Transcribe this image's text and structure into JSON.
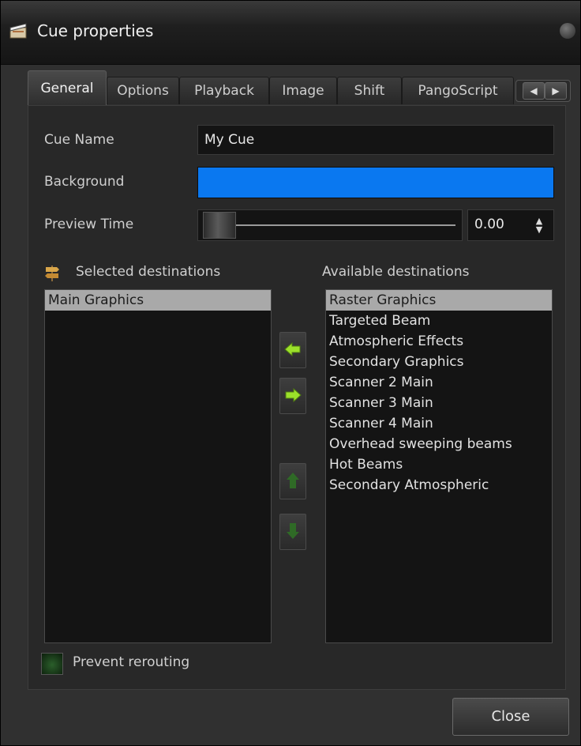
{
  "window": {
    "title": "Cue properties",
    "icon": "clapperboard-icon"
  },
  "tabs": [
    {
      "label": "General",
      "active": true
    },
    {
      "label": "Options",
      "active": false
    },
    {
      "label": "Playback",
      "active": false
    },
    {
      "label": "Image",
      "active": false
    },
    {
      "label": "Shift",
      "active": false
    },
    {
      "label": "PangoScript",
      "active": false
    }
  ],
  "general": {
    "cue_name_label": "Cue Name",
    "cue_name_value": "My Cue",
    "background_label": "Background",
    "background_color": "#0a78f0",
    "preview_time_label": "Preview Time",
    "preview_time_value": "0.00"
  },
  "destinations": {
    "selected_label": "Selected destinations",
    "available_label": "Available destinations",
    "selected": [
      "Main Graphics"
    ],
    "available": [
      "Raster Graphics",
      "Targeted Beam",
      "Atmospheric Effects",
      "Secondary Graphics",
      "Scanner 2 Main",
      "Scanner 3 Main",
      "Scanner 4 Main",
      "Overhead sweeping beams",
      "Hot Beams",
      "Secondary Atmospheric"
    ],
    "selected_highlight_index": 0,
    "available_highlight_index": 0
  },
  "prevent_rerouting_label": "Prevent rerouting",
  "close_label": "Close",
  "colors": {
    "accent_green": "#9be02a",
    "disabled_green": "#2f6a26",
    "selection": "#a9a9a9"
  }
}
